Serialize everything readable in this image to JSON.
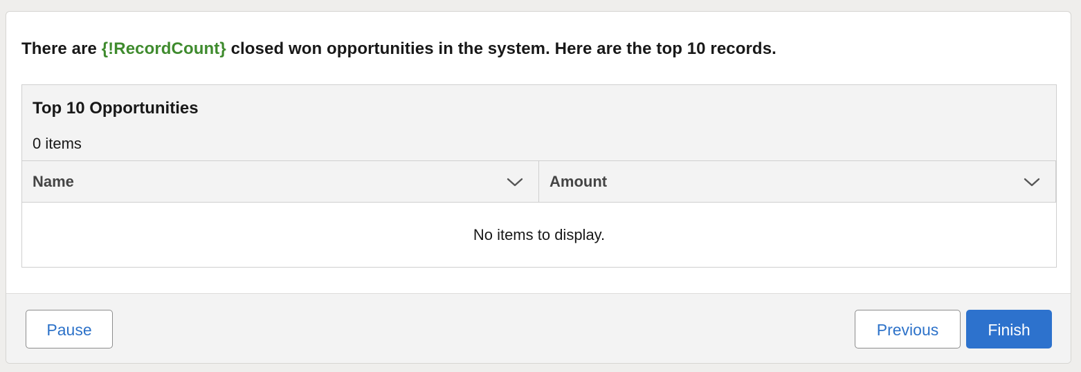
{
  "message": {
    "prefix": "There are ",
    "merge_field": "{!RecordCount}",
    "suffix": " closed won opportunities in the system. Here are the top 10 records.",
    "merge_color": "#3f8b2e"
  },
  "datatable": {
    "title": "Top 10 Opportunities",
    "item_count": "0 items",
    "columns": [
      {
        "label": "Name",
        "icon": "chevron-down-icon"
      },
      {
        "label": "Amount",
        "icon": "chevron-down-icon"
      }
    ],
    "empty_text": "No items to display."
  },
  "footer": {
    "pause_label": "Pause",
    "previous_label": "Previous",
    "finish_label": "Finish",
    "brand_color": "#2d72cd"
  }
}
